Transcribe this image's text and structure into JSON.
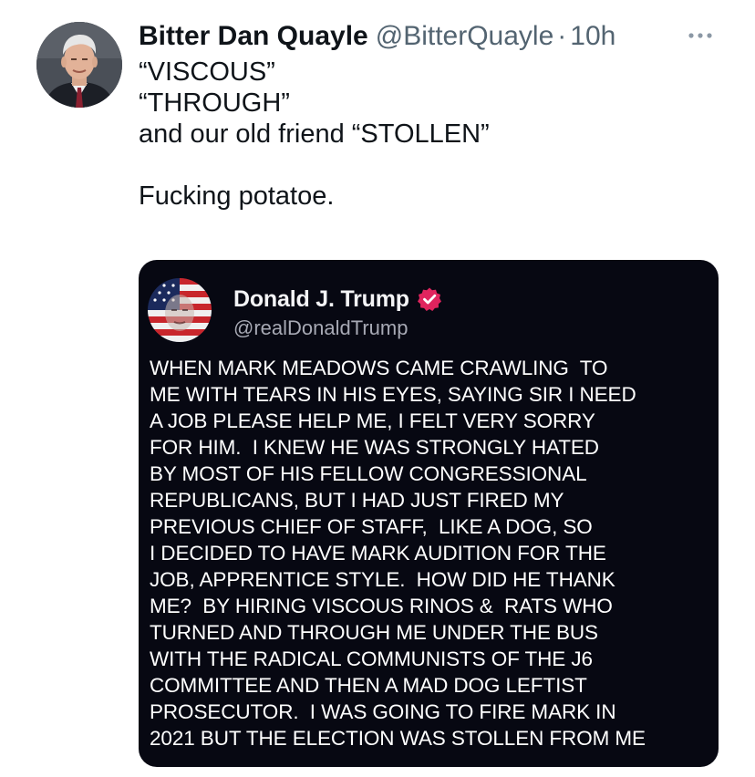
{
  "tweet": {
    "display_name": "Bitter Dan Quayle",
    "handle": "@BitterQuayle",
    "separator": "·",
    "time": "10h",
    "text_lines": [
      "“VISCOUS”",
      "“THROUGH”",
      "and our old friend “STOLLEN”",
      "",
      "Fucking potatoe."
    ],
    "more_icon": "ellipsis-icon"
  },
  "embedded_image": {
    "display_name": "Donald J. Trump",
    "verified_icon": "verified-badge-icon",
    "verified_color": "#e0245e",
    "handle": "@realDonaldTrump",
    "body_lines": [
      "WHEN MARK MEADOWS CAME CRAWLING  TO",
      "ME WITH TEARS IN HIS EYES, SAYING SIR I NEED",
      "A JOB PLEASE HELP ME, I FELT VERY SORRY",
      "FOR HIM.  I KNEW HE WAS STRONGLY HATED",
      "BY MOST OF HIS FELLOW CONGRESSIONAL",
      "REPUBLICANS, BUT I HAD JUST FIRED MY",
      "PREVIOUS CHIEF OF STAFF,  LIKE A DOG, SO",
      "I DECIDED TO HAVE MARK AUDITION FOR THE",
      "JOB, APPRENTICE STYLE.  HOW DID HE THANK",
      "ME?  BY HIRING VISCOUS RINOS &  RATS WHO",
      "TURNED AND THROUGH ME UNDER THE BUS",
      "WITH THE RADICAL COMMUNISTS OF THE J6",
      "COMMITTEE AND THEN A MAD DOG LEFTIST",
      "PROSECUTOR.  I WAS GOING TO FIRE MARK IN",
      "2021 BUT THE ELECTION WAS STOLLEN FROM ME"
    ],
    "background_color": "#070812"
  }
}
